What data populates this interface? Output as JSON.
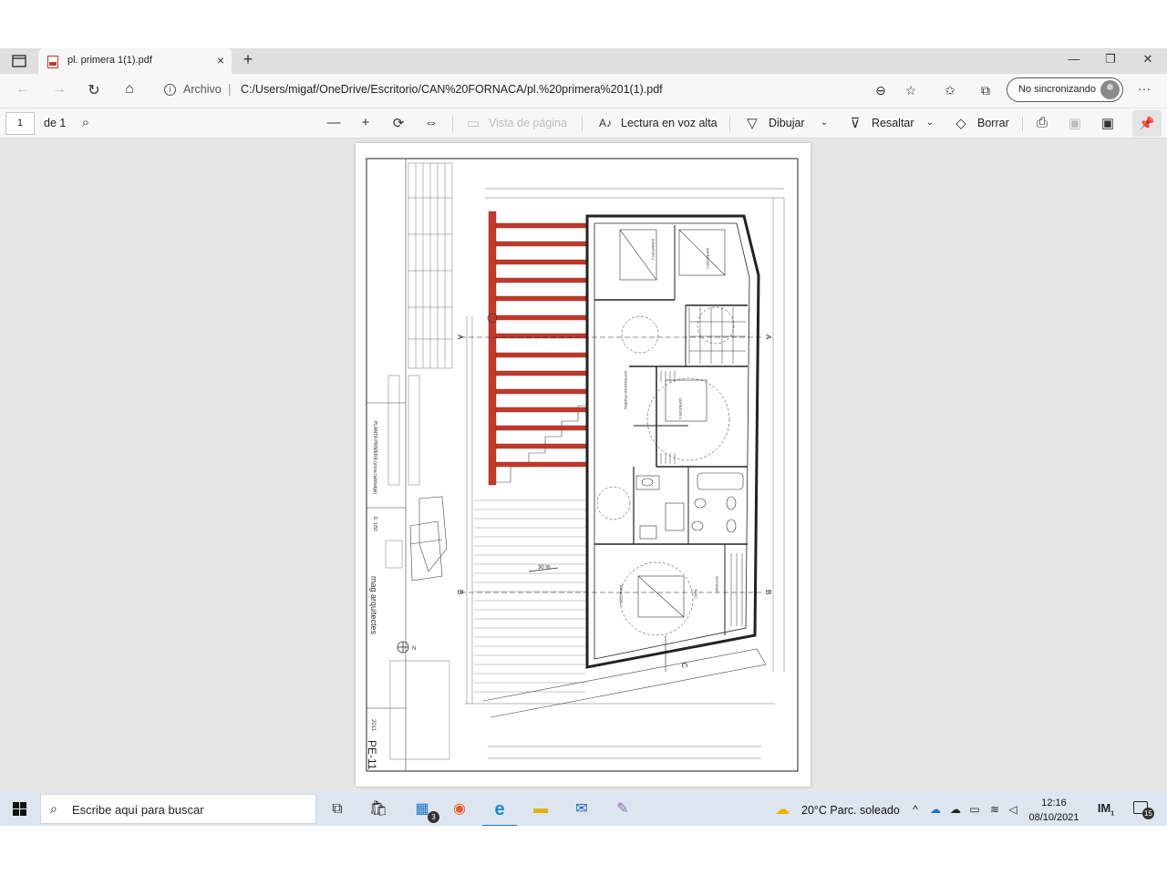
{
  "browser": {
    "tab": {
      "title": "pl. primera 1(1).pdf",
      "close": "×"
    },
    "new_tab": "+",
    "window_controls": [
      "—",
      "❐",
      "✕"
    ],
    "address": {
      "scheme_label": "Archivo",
      "url": "C:/Users/migaf/OneDrive/Escritorio/CAN%20FORNACA/pl.%20primera%201(1).pdf"
    },
    "profile": {
      "label": "No sincronizando"
    },
    "more": "···"
  },
  "pdf_toolbar": {
    "page_number": "1",
    "page_total": "de 1",
    "page_view": "Vista de página",
    "read_aloud": "Lectura en voz alta",
    "draw": "Dibujar",
    "highlight": "Resaltar",
    "erase": "Borrar"
  },
  "drawing": {
    "scale_label": "E: 1/50",
    "firm": "mag arquitectes",
    "sheet_id": "PE-11",
    "year": "2011",
    "plan_title": "PLANTA PRIMERA (zona habitatge)",
    "slope": "30 %",
    "section_a": "A",
    "section_b": "B",
    "section_c": "C",
    "north": "N",
    "rooms": [
      "DORMITORI 2",
      "DORMITORI 1",
      "DORMITORI 3",
      "DISTRIBUIDOR PRIMERA",
      "DORMITORI 4",
      "VESTIDOR",
      "BANY"
    ]
  },
  "taskbar": {
    "search_placeholder": "Escribe aquí para buscar",
    "apps": [
      {
        "name": "task-view",
        "glyph": "⧉"
      },
      {
        "name": "store",
        "glyph": "🛍"
      },
      {
        "name": "files",
        "glyph": "▦",
        "badge": "3"
      },
      {
        "name": "firefox",
        "glyph": "◉"
      },
      {
        "name": "edge",
        "glyph": "e"
      },
      {
        "name": "explorer",
        "glyph": "▬"
      },
      {
        "name": "outlook",
        "glyph": "✉"
      },
      {
        "name": "paint",
        "glyph": "✎"
      }
    ],
    "weather": "20°C  Parc. soleado",
    "time": "12:16",
    "date": "08/10/2021",
    "notifications": "15",
    "ime": "1"
  },
  "colors": {
    "accent": "#1a73c7",
    "beam": "#c0392b"
  }
}
